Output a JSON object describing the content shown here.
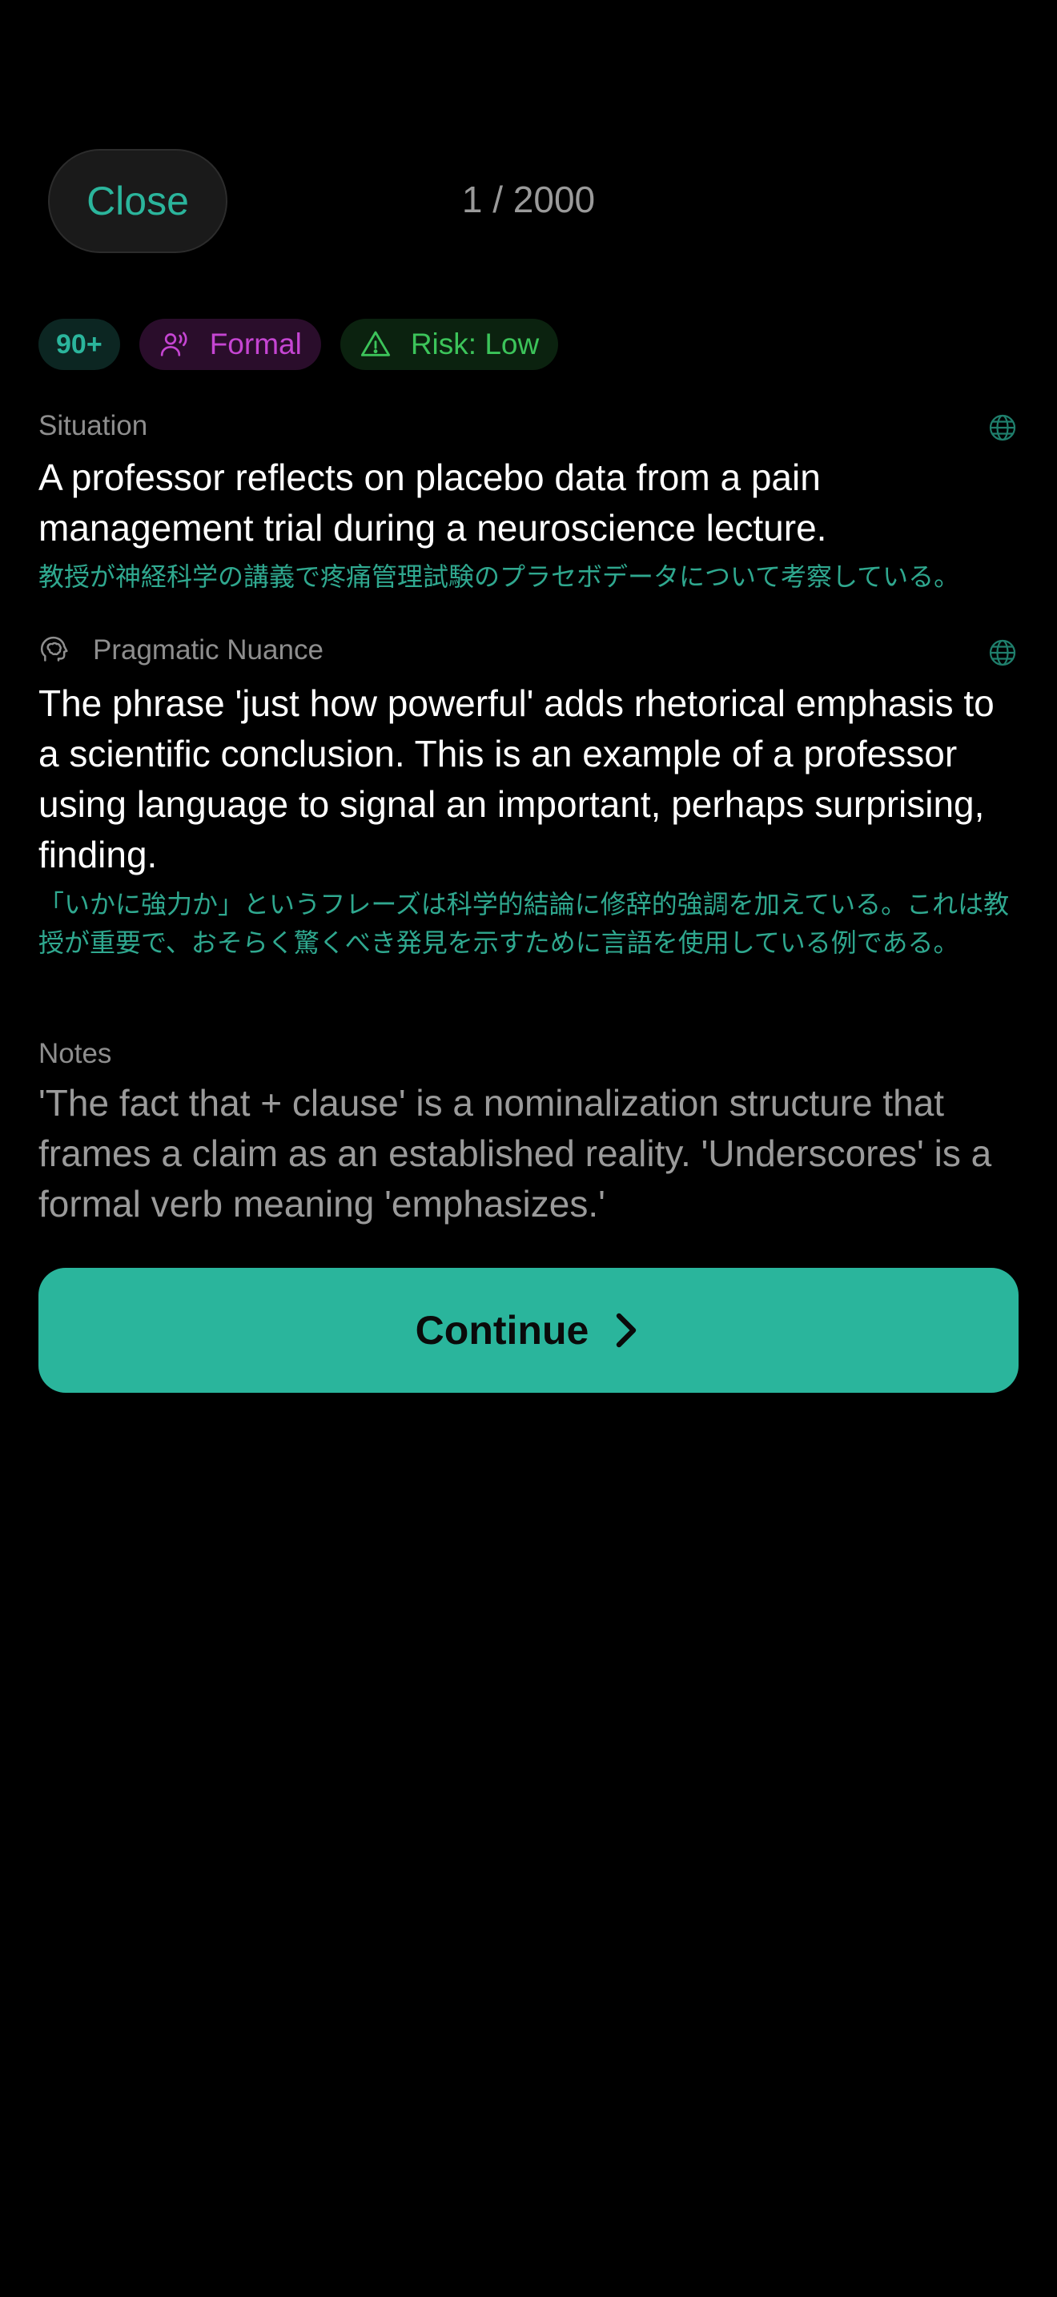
{
  "header": {
    "close_label": "Close",
    "counter": "1 / 2000"
  },
  "tags": {
    "level": "90+",
    "register": "Formal",
    "risk": "Risk: Low"
  },
  "situation": {
    "label": "Situation",
    "text": "A professor reflects on placebo data from a pain management trial during a neuroscience lecture.",
    "translation": "教授が神経科学の講義で疼痛管理試験のプラセボデータについて考察している。"
  },
  "nuance": {
    "label": "Pragmatic Nuance",
    "text": "The phrase 'just how powerful' adds rhetorical emphasis to a scientific conclusion. This is an example of a professor using language to signal an important, perhaps surprising, finding.",
    "translation": "「いかに強力か」というフレーズは科学的結論に修辞的強調を加えている。これは教授が重要で、おそらく驚くべき発見を示すために言語を使用している例である。"
  },
  "notes": {
    "label": "Notes",
    "text": "'The fact that + clause' is a nominalization structure that frames a claim as an established reality. 'Underscores' is a formal verb meaning 'emphasizes.'"
  },
  "continue_label": "Continue",
  "colors": {
    "accent": "#2ab59c",
    "formal": "#c545d2",
    "risk_low": "#3cc45a",
    "background": "#000000"
  },
  "icons": {
    "formal": "speaking-person-icon",
    "risk": "warning-triangle-icon",
    "nuance": "brain-head-icon",
    "translate": "globe-icon",
    "continue": "chevron-right-icon"
  }
}
